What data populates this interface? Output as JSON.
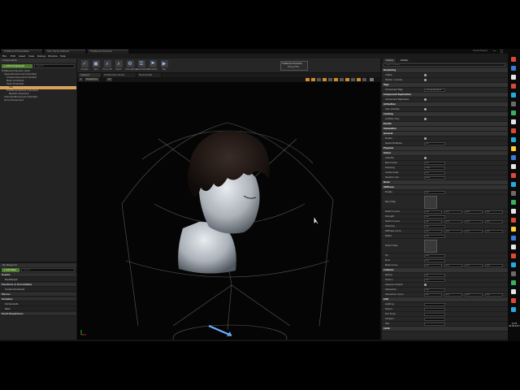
{
  "window": {
    "tabs": [
      "FirstPersonExampleMap",
      "Hair_Hybrid_Material",
      "FirstPersonCharacter"
    ],
    "title": "Unreal Engine",
    "min": "—",
    "max": "□",
    "close": "✕"
  },
  "menu": [
    "File",
    "Edit",
    "Asset",
    "View",
    "Debug",
    "Window",
    "Help"
  ],
  "components": {
    "header": "Components",
    "add_button": "+ Add Component",
    "search_placeholder": "Search",
    "items": [
      {
        "label": "FirstPersonCharacter (Self)",
        "indent": 0,
        "selected": false
      },
      {
        "label": "CapsuleComponent (Inherited)",
        "indent": 1,
        "selected": false
      },
      {
        "label": "ArrowComponent (Inherited)",
        "indent": 2,
        "selected": false
      },
      {
        "label": "Mesh (Inherited)",
        "indent": 2,
        "selected": false
      },
      {
        "label": "Head (Inherited)",
        "indent": 2,
        "selected": false
      },
      {
        "label": "Hair",
        "indent": 3,
        "selected": true
      },
      {
        "label": "FirstPersonCamera (Inherited)",
        "indent": 2,
        "selected": false
      },
      {
        "label": "Mesh1P (Inherited)",
        "indent": 3,
        "selected": false
      },
      {
        "label": "CharacterMovement (Inherited)",
        "indent": 1,
        "selected": false
      },
      {
        "label": "GroomComponent",
        "indent": 1,
        "selected": false
      }
    ]
  },
  "my_blueprint": {
    "header": "My Blueprint",
    "add_new": "+ Add New",
    "search_placeholder": "Search",
    "rows": [
      {
        "label": "Graphs",
        "cat": true
      },
      {
        "label": "EventGraph",
        "cat": false
      },
      {
        "label": "Functions (3 Overridable)",
        "cat": true
      },
      {
        "label": "ConstructionScript",
        "cat": false
      },
      {
        "label": "Macros",
        "cat": true
      },
      {
        "label": "Variables",
        "cat": true
      },
      {
        "label": "Components",
        "cat": false
      },
      {
        "label": "Pawn",
        "cat": false
      },
      {
        "label": "Event Dispatchers",
        "cat": true
      }
    ]
  },
  "toolbar": {
    "tools": [
      {
        "label": "Compile",
        "icon": "compile-icon",
        "glyph": "✓"
      },
      {
        "label": "Save",
        "icon": "save-icon",
        "glyph": "▣"
      },
      {
        "label": "Find in CB",
        "icon": "browse-icon",
        "glyph": "⌕"
      },
      {
        "label": "Search",
        "icon": "search-icon",
        "glyph": "⌕"
      },
      {
        "label": "Class Settings",
        "icon": "settings-icon",
        "glyph": "⚙"
      },
      {
        "label": "Class Defaults",
        "icon": "defaults-icon",
        "glyph": "☰"
      },
      {
        "label": "Simulation",
        "icon": "simulation-icon",
        "glyph": "⚑"
      },
      {
        "label": "Play",
        "icon": "play-icon",
        "glyph": "▶"
      }
    ],
    "preview_label": "FirstPersonCharacter",
    "debug_filter": "Debug Filter"
  },
  "editor_tabs": [
    "Viewport",
    "Construction Script",
    "Event Graph"
  ],
  "viewport": {
    "view_button": "Perspective",
    "lit_button": "Lit"
  },
  "details": {
    "tabs": [
      "Details",
      "Palette"
    ],
    "search_placeholder": "Search Details",
    "rows": [
      {
        "name": "Rendering",
        "kind": "cat"
      },
      {
        "name": "Visible",
        "kind": "check"
      },
      {
        "name": "Hidden in Game",
        "kind": "check"
      },
      {
        "name": "Tags",
        "kind": "cat"
      },
      {
        "name": "Component Tags",
        "kind": "field",
        "value": "0 Array elements"
      },
      {
        "name": "Component Replication",
        "kind": "cat"
      },
      {
        "name": "Component Replicates",
        "kind": "check"
      },
      {
        "name": "Activation",
        "kind": "cat"
      },
      {
        "name": "Auto Activate",
        "kind": "check"
      },
      {
        "name": "Cooking",
        "kind": "cat"
      },
      {
        "name": "Is Editor Only",
        "kind": "check"
      },
      {
        "name": "Events",
        "kind": "cat"
      },
      {
        "name": "Simulation",
        "kind": "cat"
      },
      {
        "name": "General",
        "kind": "cat"
      },
      {
        "name": "Enable",
        "kind": "check"
      },
      {
        "name": "Speed Multiplier",
        "kind": "field",
        "value": "1.0"
      },
      {
        "name": "Physical",
        "kind": "cat"
      },
      {
        "name": "Solver",
        "kind": "cat"
      },
      {
        "name": "Activate",
        "kind": "check"
      },
      {
        "name": "Bend Scale",
        "kind": "field",
        "value": "1.0"
      },
      {
        "name": "Damping",
        "kind": "field",
        "value": "0.05"
      },
      {
        "name": "Inertia Scale",
        "kind": "field",
        "value": "0.5"
      },
      {
        "name": "Iteration Inst",
        "kind": "field",
        "value": "20.0"
      },
      {
        "name": "Bend",
        "kind": "cat"
      },
      {
        "name": "Stiffness",
        "kind": "cat"
      },
      {
        "name": "Enable",
        "kind": "field",
        "value": "0.4"
      },
      {
        "name": "Bend Map",
        "kind": "thumb"
      },
      {
        "name": "Stretch Curve",
        "kind": "multi",
        "values": [
          "0.0",
          "0.0",
          "0.0",
          "0.0"
        ]
      },
      {
        "name": "Strength",
        "kind": "field",
        "value": "1.0"
      },
      {
        "name": "Stretch Curve",
        "kind": "multi",
        "values": [
          "0.0",
          "1.0",
          "1.0",
          "0.0"
        ]
      },
      {
        "name": "Damping",
        "kind": "field",
        "value": "0.5"
      },
      {
        "name": "Stiffness Curve",
        "kind": "multi",
        "values": [
          "0.0",
          "0.0",
          "1.0",
          "1.0"
        ]
      },
      {
        "name": "Plastic",
        "kind": "field",
        "value": "0.0"
      },
      {
        "name": "Stretch Map",
        "kind": "thumb"
      },
      {
        "name": "Tip",
        "kind": "field",
        "value": "0.0"
      },
      {
        "name": "Root",
        "kind": "field",
        "value": "1.0"
      },
      {
        "name": "Mask Curve",
        "kind": "multi",
        "values": [
          "0.0",
          "0.0",
          "0.0",
          "0.0"
        ]
      },
      {
        "name": "Collision",
        "kind": "cat"
      },
      {
        "name": "Radius",
        "kind": "field",
        "value": "0.1"
      },
      {
        "name": "Friction",
        "kind": "field",
        "value": "0.5"
      },
      {
        "name": "Capsule Collision",
        "kind": "check"
      },
      {
        "name": "Interaction",
        "kind": "field",
        "value": "0.0"
      },
      {
        "name": "Interaction Curve",
        "kind": "multi",
        "values": [
          "0.0",
          "0.0",
          "0.0",
          "0.0"
        ]
      },
      {
        "name": "LOD",
        "kind": "cat"
      },
      {
        "name": "Lighting",
        "kind": "field",
        "value": ""
      },
      {
        "name": "Strand",
        "kind": "field",
        "value": ""
      },
      {
        "name": "Sim Props",
        "kind": "field",
        "value": ""
      },
      {
        "name": "Collision",
        "kind": "field",
        "value": ""
      },
      {
        "name": "Hair",
        "kind": "field",
        "value": ""
      },
      {
        "name": "Cloth",
        "kind": "cat"
      }
    ]
  },
  "taskbar": {
    "time": "10:22",
    "date": "28.08.2017",
    "colors": [
      "#d84a38",
      "#3a7bd5",
      "#e6e6e6",
      "#d84a38",
      "#29a8e0",
      "#6a6a6a",
      "#3aaf5d",
      "#e6e6e6",
      "#d84a38",
      "#29a8e0",
      "#ffcc33",
      "#3a7bd5",
      "#e6e6e6",
      "#d84a38",
      "#29a8e0",
      "#6a6a6a",
      "#3aaf5d",
      "#e6e6e6",
      "#d84a38",
      "#ffcc33",
      "#3a7bd5",
      "#e6e6e6",
      "#d84a38",
      "#29a8e0",
      "#6a6a6a",
      "#3aaf5d",
      "#e6e6e6",
      "#d84a38",
      "#29a8e0"
    ]
  },
  "colors": {
    "accent_orange": "#d9a25a",
    "add_green": "#4c7a2a",
    "viewport_bg": "#050505"
  }
}
